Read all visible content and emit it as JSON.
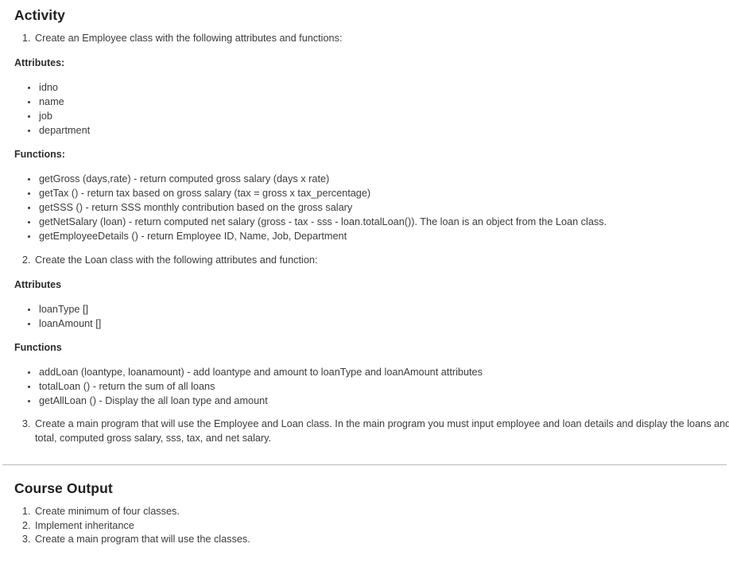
{
  "activity": {
    "heading": "Activity",
    "item1": "Create an Employee class with the following attributes and functions:",
    "employee": {
      "attributes_heading": "Attributes:",
      "attributes": [
        "idno",
        "name",
        "job",
        "department"
      ],
      "functions_heading": "Functions:",
      "functions": [
        "getGross (days,rate) - return computed gross salary (days x rate)",
        "getTax () - return tax based on gross salary (tax = gross x tax_percentage)",
        "getSSS () - return SSS monthly contribution based on the gross salary",
        "getNetSalary (loan) - return computed net salary (gross - tax - sss - loan.totalLoan()). The loan is an object from the Loan class.",
        "getEmployeeDetails () - return Employee ID, Name, Job, Department"
      ]
    },
    "item2": "Create the Loan class with the following attributes and function:",
    "loan": {
      "attributes_heading": "Attributes",
      "attributes": [
        "loanType []",
        "loanAmount []"
      ],
      "functions_heading": "Functions",
      "functions": [
        "addLoan (loantype, loanamount) - add loantype and amount to loanType and loanAmount attributes",
        "totalLoan () - return the sum of all loans",
        "getAllLoan () - Display the all loan type and amount"
      ]
    },
    "item3": "Create a main program that will use the Employee and Loan class. In the main program you must input employee and loan details and display the loans and its total, computed gross salary, sss, tax, and net salary."
  },
  "course_output": {
    "heading": "Course Output",
    "items": [
      "Create minimum of four classes.",
      "Implement inheritance",
      "Create a main program that will use the classes."
    ]
  },
  "colors": {
    "background": "#ffffff",
    "text": "#3c3c3c",
    "heading": "#202020",
    "divider": "#b9b9b9"
  }
}
